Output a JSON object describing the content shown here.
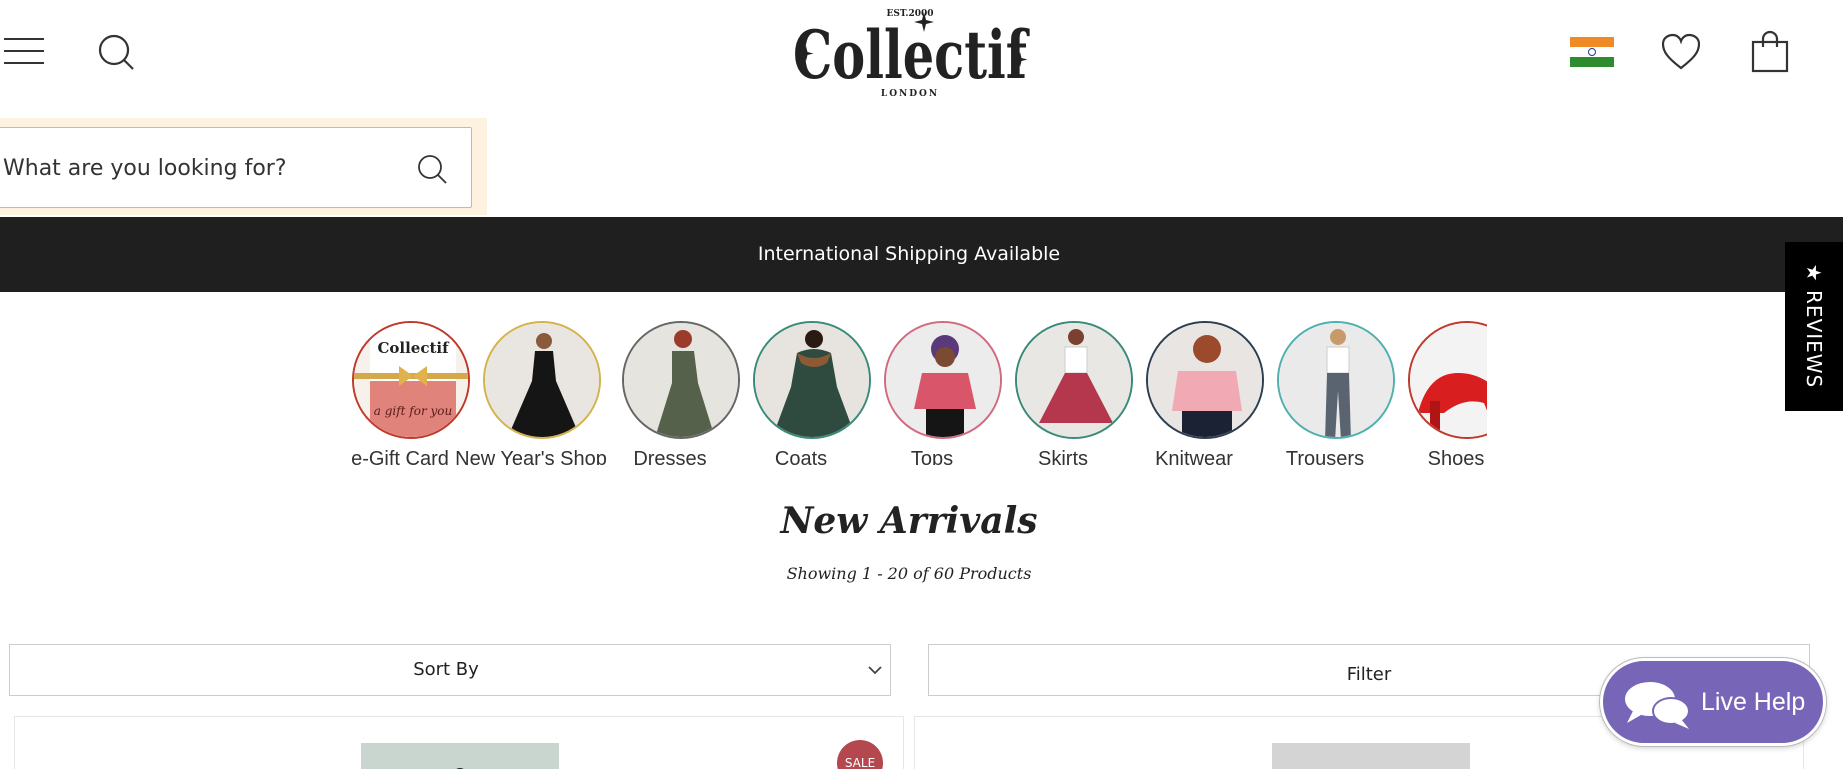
{
  "header": {
    "logo_text": "Collectif",
    "logo_est": "EST.2000",
    "logo_sub": "LONDON",
    "icons": [
      "menu-icon",
      "search-icon",
      "india-flag-icon",
      "heart-icon",
      "shopping-bag-icon"
    ]
  },
  "search": {
    "placeholder": "What are you looking for?",
    "icon": "search-icon"
  },
  "banner": {
    "text": "International Shipping Available"
  },
  "reviews_tab": {
    "label": "★ REVIEWS"
  },
  "categories": [
    {
      "label": "e-Gift Card",
      "ring": "#c0392b"
    },
    {
      "label": "New Year's Shop",
      "ring": "#d4b24c"
    },
    {
      "label": "Dresses",
      "ring": "#666666"
    },
    {
      "label": "Coats",
      "ring": "#3a8a7a"
    },
    {
      "label": "Tops",
      "ring": "#d16a7f"
    },
    {
      "label": "Skirts",
      "ring": "#3a8a7a"
    },
    {
      "label": "Knitwear",
      "ring": "#2c3e50"
    },
    {
      "label": "Trousers",
      "ring": "#4fb0b0"
    },
    {
      "label": "Shoes",
      "ring": "#c0392b"
    }
  ],
  "main": {
    "title": "New Arrivals",
    "count_text": "Showing 1 - 20 of 60 Products"
  },
  "controls": {
    "sort_label": "Sort By",
    "filter_label": "Filter"
  },
  "products": [
    {
      "badge": "SALE"
    },
    {
      "badge": ""
    }
  ],
  "live_help": {
    "label": "Live Help"
  },
  "colors": {
    "banner_bg": "#1f1f1f",
    "search_bg": "#fdf1df",
    "live_help_bg": "#7766b8",
    "sale_badge": "#b5474f"
  }
}
